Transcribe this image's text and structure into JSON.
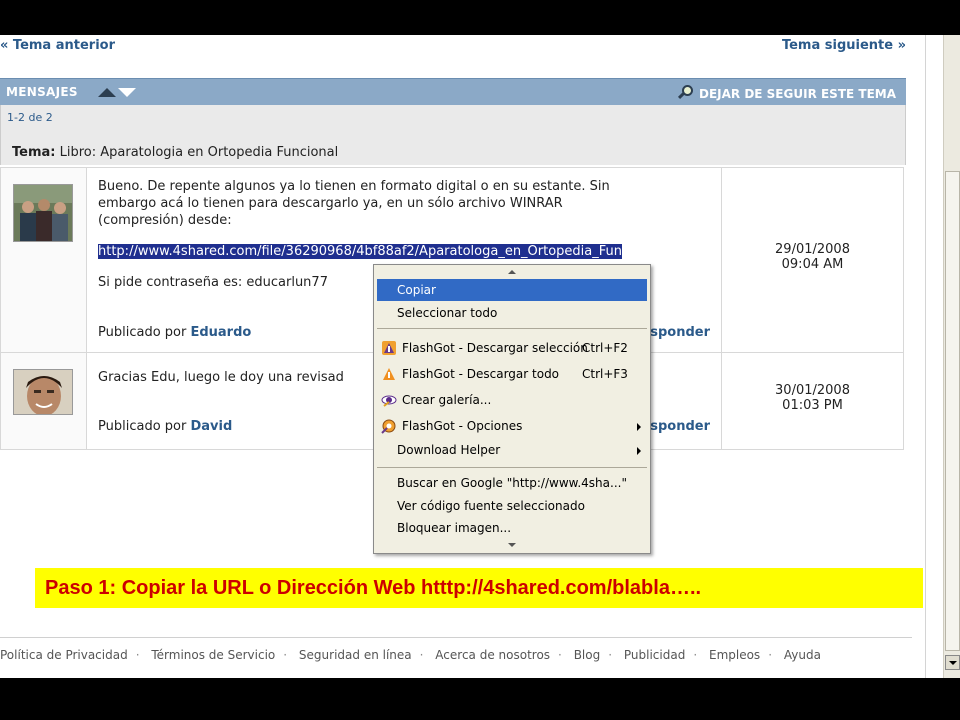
{
  "nav": {
    "prev": "« Tema anterior",
    "next": "Tema siguiente »"
  },
  "header": {
    "title": "MENSAJES",
    "unfollow": "DEJAR DE SEGUIR ESTE TEMA"
  },
  "thread": {
    "count": "1-2 de 2",
    "topic_label": "Tema:",
    "topic": "Libro: Aparatologia en Ortopedia Funcional"
  },
  "posts": [
    {
      "lines": [
        "Bueno. De repente algunos ya lo tienen en formato digital o en su estante. Sin",
        "embargo acá lo tienen para descargarlo ya, en un sólo archivo WINRAR",
        "(compresión) desde:"
      ],
      "url": "http://www.4shared.com/file/36290968/4bf88af2/Aparatologa_en_Ortopedia_Fun",
      "password_line": "Si pide contraseña es: educarlun77",
      "published_by": "Publicado por",
      "author": "Eduardo",
      "reply": "sponder",
      "date": "29/01/2008",
      "time": "09:04 AM"
    },
    {
      "lines": [
        "Gracias Edu, luego le doy una revisad"
      ],
      "published_by": "Publicado por",
      "author": "David",
      "reply": "sponder",
      "date": "30/01/2008",
      "time": "01:03 PM"
    }
  ],
  "context_menu": {
    "items": [
      {
        "label": "Copiar",
        "selected": true
      },
      {
        "label": "Seleccionar todo"
      },
      {
        "label": "FlashGot - Descargar selección",
        "shortcut": "Ctrl+F2",
        "icon": "flashgot-icon"
      },
      {
        "label": "FlashGot - Descargar todo",
        "shortcut": "Ctrl+F3",
        "icon": "flashgot-icon"
      },
      {
        "label": "Crear galería...",
        "icon": "eye-icon"
      },
      {
        "label": "FlashGot - Opciones",
        "icon": "flashgot-options-icon",
        "submenu": true
      },
      {
        "label": "Download Helper",
        "submenu": true
      },
      {
        "label": "Buscar en Google \"http://www.4sha...\""
      },
      {
        "label": "Ver código fuente seleccionado"
      },
      {
        "label": "Bloquear imagen..."
      }
    ]
  },
  "caption": "Paso 1: Copiar la URL o Dirección Web htttp://4shared.com/blabla…..",
  "footer": {
    "links": [
      "Política de Privacidad",
      "Términos de Servicio",
      "Seguridad en línea",
      "Acerca de nosotros",
      "Blog",
      "Publicidad",
      "Empleos",
      "Ayuda"
    ]
  },
  "colors": {
    "header_bar": "#8ba9c7",
    "link": "#2b5a8a",
    "caption_bg": "#ffff00",
    "caption_text": "#cc0000",
    "menu_selected": "#316ac5"
  }
}
